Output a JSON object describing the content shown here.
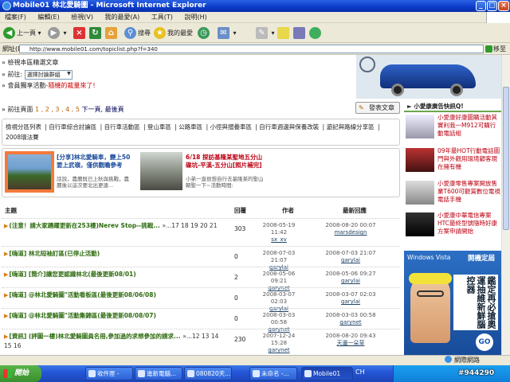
{
  "window": {
    "title": "Mobile01 林北愛騎圖 - Microsoft Internet Explorer",
    "min": "_",
    "max": "□",
    "close": "×"
  },
  "menu": [
    "檔案(F)",
    "編輯(E)",
    "檢視(V)",
    "我的最愛(A)",
    "工具(T)",
    "說明(H)"
  ],
  "toolbar": {
    "back": "上一頁",
    "search": "搜尋",
    "favorites": "我的最愛"
  },
  "address": {
    "label": "網址(D)",
    "url": "http://www.mobile01.com/topiclist.php?f=340",
    "go": "移至"
  },
  "top_lines": {
    "line1": "» 檢視本區精選文章",
    "goto_label": "» 前往:",
    "goto_select": "選擇討論群組",
    "line3_prefix": "» 會員獨享活動-",
    "line3_red": "隨機的裁量來了!"
  },
  "pager": {
    "prefix": "» 前往頁面",
    "pages": "1 , 2 , 3 , 4 , 5",
    "next": "下一頁,",
    "last": "最後頁"
  },
  "post_button": "發表文章",
  "categories": [
    "檢視分區列表",
    "自行車綜合討論區",
    "自行車活動區",
    "登山車區",
    "公路車區",
    "小徑與摺疊車區",
    "自行車週邊與保養改裝",
    "遊記與路線分享區",
    "2008環法賽"
  ],
  "featured": [
    {
      "title": "[分享]林北愛騎車，變上50要上武嶺，僅供觀瞻參考",
      "desc": "話說，農曆既已上秋與挑戰，農曆後以這次要北出更遠..."
    },
    {
      "title": "6/18 探訪基隆某聖地五分山 碟坑-平溪-五分山[照片補完]",
      "desc": "小弟一直很想自行去基隆某的聖山朝聖一下~活動時間:"
    }
  ],
  "table": {
    "headers": {
      "topic": "主題",
      "replies": "回覆",
      "author": "作者",
      "last": "最新回應"
    },
    "rows": [
      {
        "title": "(注意！請大家踴躍更新在253樓)Nerev Stop--挑戰...",
        "pages": "»...17 18 19 20 21",
        "replies": "303",
        "author_date": "2008-05-19 11:42",
        "author": "sx_xv",
        "last_date": "2008-08-20 00:07",
        "last_user": "marsdesign"
      },
      {
        "title": "[嗨道] 林北短袖訂區(已停止活動)",
        "pages": "",
        "replies": "0",
        "author_date": "2008-07-03 21:07",
        "author": "garylai",
        "last_date": "2008-07-03 21:07",
        "last_user": "garylai"
      },
      {
        "title": "[嗨道] [簡介]讓您更認識林北(最後更新08/01)",
        "pages": "",
        "replies": "2",
        "author_date": "2008-05-06 09:21",
        "author": "garynet",
        "last_date": "2008-05-06 09:27",
        "last_user": "garylai"
      },
      {
        "title": "[嗨道] @林北愛騎圖\"活動看板區(最後更新08/06/08)",
        "pages": "",
        "replies": "0",
        "author_date": "2008-03-07 02:03",
        "author": "garylai",
        "last_date": "2008-03-07 02:03",
        "last_user": "garylai"
      },
      {
        "title": "[嗨道] @林北愛騎圖\"活動集錦區(最後更新08/08/07)",
        "pages": "",
        "replies": "0",
        "author_date": "2008-03-03 00:58",
        "author": "garynet",
        "last_date": "2008-03-03 00:58",
        "last_user": "garynet"
      },
      {
        "title": "[資訊] (評圖一樓)林北愛騎圖員名冊,參加過的求想參加的請求...",
        "pages": "»...12 13 14 15 16",
        "replies": "230",
        "author_date": "2007-12-24 15:28",
        "author": "garynet",
        "last_date": "2008-08-20 09:43",
        "last_user": "天邊一朵草"
      }
    ]
  },
  "right": {
    "header": "► 小愛康廣告快訊Q!",
    "items": [
      "小愛康好康圖購活動其實利我一M912可購行動電話組",
      "09年最HOT行動電話圖門與外觀用環境顧客現在擁有機",
      "小愛康零售專案開放售業T600可觀賞數位電視電話手機",
      "小愛康中華電信專案HTC最終型號隨時好康方案申請開始"
    ],
    "vista_logo": "Windows Vista",
    "vista_head": "開機定屆",
    "vista_text": "鑑定再必搶奧運抽維新鮮腦控器",
    "vista_go": "GO"
  },
  "status": {
    "left": "",
    "zone": "網際網路"
  },
  "taskbar": {
    "start": "開始",
    "tasks": [
      "收件匣 -",
      "進新電腦...",
      "080820天...",
      "未命名 -...",
      "Mobile01"
    ],
    "ime": "CH",
    "watermark": "#944290"
  }
}
